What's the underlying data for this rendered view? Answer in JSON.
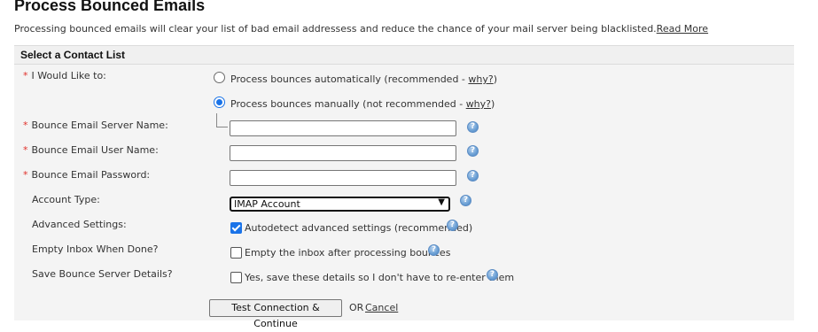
{
  "page": {
    "title": "Process Bounced Emails",
    "intro": "Processing bounced emails will clear your list of bad email addressess and reduce the chance of your mail server being blacklisted.",
    "read_more": "Read More"
  },
  "panel": {
    "header": "Select a Contact List"
  },
  "form": {
    "required_mark": "*",
    "mode_label": "I Would Like to:",
    "mode_options": [
      {
        "prefix": "Process bounces automatically (recommended - ",
        "link": "why?",
        "suffix": ")",
        "selected": false
      },
      {
        "prefix": "Process bounces manually (not recommended - ",
        "link": "why?",
        "suffix": ")",
        "selected": true
      }
    ],
    "server_label": "Bounce Email Server Name:",
    "server_value": "",
    "user_label": "Bounce Email User Name:",
    "user_value": "",
    "password_label": "Bounce Email Password:",
    "password_value": "",
    "account_type_label": "Account Type:",
    "account_type_value": "IMAP Account",
    "advanced_label": "Advanced Settings:",
    "advanced_option": "Autodetect advanced settings (recommended)",
    "advanced_checked": true,
    "empty_label": "Empty Inbox When Done?",
    "empty_option": "Empty the inbox after processing bounces",
    "empty_checked": false,
    "save_label": "Save Bounce Server Details?",
    "save_option": "Yes, save these details so I don't have to re-enter them",
    "save_checked": false,
    "help_glyph": "?"
  },
  "actions": {
    "submit": "Test Connection & Continue",
    "or": "OR",
    "cancel": "Cancel"
  },
  "colors": {
    "required": "#e0302a",
    "accent": "#1a73e8",
    "panel_bg": "#f4f4f4"
  },
  "icons": {
    "help": "help-question-icon",
    "select_arrow": "chevron-down-icon"
  }
}
